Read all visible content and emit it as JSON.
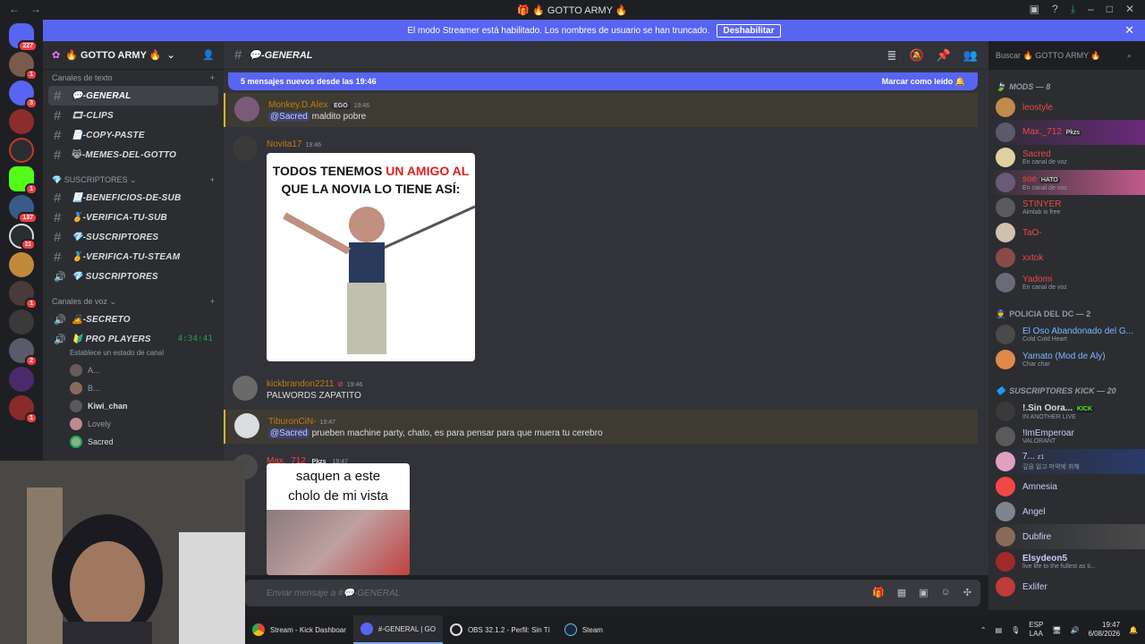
{
  "window": {
    "title": "GOTTO ARMY"
  },
  "banner": {
    "text": "El modo Streamer está habilitado. Los nombres de usuario se han truncado.",
    "button": "Deshabilitar"
  },
  "servers": {
    "badges": [
      "227",
      "1",
      "3",
      "",
      "",
      "",
      "1",
      "1",
      "137",
      "11",
      "",
      "1",
      "1",
      "",
      "2",
      "1",
      "",
      "1"
    ]
  },
  "guild": {
    "name": "GOTTO ARMY"
  },
  "sidebar": {
    "cat_text": "Canales de texto",
    "text_channels": [
      "-GENERAL",
      "-CLIPS",
      "-COPY-PASTE",
      "-MEMES-DEL-GOTTO"
    ],
    "cat_subs": "SUSCRIPTORES",
    "sub_channels": [
      "-BENEFICIOS-DE-SUB",
      "-VERIFICA-TU-SUB",
      "-SUSCRIPTORES",
      "-VERIFICA-TU-STEAM",
      "SUSCRIPTORES"
    ],
    "cat_voice": "Canales de voz",
    "voice_channels": [
      "-SECRETO",
      "PRO PLAYERS"
    ],
    "voice_timer": "4:34:41",
    "voice_status": "Establece un estado de canal",
    "voice_users": [
      "A...",
      "B...",
      "Kiwi_chan",
      "Lovely",
      "Sacred"
    ]
  },
  "chat": {
    "channel": "-GENERAL",
    "new_messages": "5 mensajes nuevos desde las 19:46",
    "mark_read": "Marcar como leído",
    "messages": [
      {
        "user": "Monkey.D.Alex",
        "tag": "EGO",
        "time": "19:46",
        "mention": "@Sacred",
        "text": "maldito pobre"
      },
      {
        "user": "Novita17",
        "time": "19:46"
      },
      {
        "user": "kickbrandon2211",
        "time": "19:46",
        "text": "PALWORDS ZAPATITO"
      },
      {
        "user": "TiburonCiN-",
        "time": "19:47",
        "mention": "@Sacred",
        "text": "prueben machine party, chato, es para pensar para que muera tu cerebro"
      },
      {
        "user": "Max._712",
        "tag": "Pkzs",
        "time": "19:47"
      }
    ],
    "meme1": {
      "line1": "TODOS TENEMOS ",
      "line1_red": "UN AMIGO AL",
      "line2": "QUE LA NOVIA LO TIENE ASÍ:"
    },
    "meme2": {
      "line1": "saquen a este",
      "line2": "cholo de mi vista"
    },
    "input_placeholder": "Enviar mensaje a #",
    "input_channel": "-GENERAL"
  },
  "search": {
    "placeholder": "Buscar",
    "scope": "GOTTO ARMY"
  },
  "members": {
    "mods_header": "MODS — 8",
    "mods": [
      {
        "name": "leostyle",
        "color": "#f04747"
      },
      {
        "name": "Max._712",
        "tag": "Pkzs",
        "color": "#f04747"
      },
      {
        "name": "Sacred",
        "status": "En canal de voz",
        "color": "#f04747"
      },
      {
        "name": "soe",
        "tag": "HATO",
        "status": "En canal de voz",
        "color": "#f04747"
      },
      {
        "name": "STINYER",
        "status": "Aimlab is free",
        "color": "#f04747"
      },
      {
        "name": "TaO-",
        "color": "#f04747"
      },
      {
        "name": "xxtok",
        "color": "#f04747"
      },
      {
        "name": "Yadomi",
        "status": "En canal de voz",
        "color": "#f04747"
      }
    ],
    "policia_header": "POLICIA DEL DC — 2",
    "policia": [
      {
        "name": "El Oso Abandonado del G...",
        "status": "Cold Cold Heart",
        "color": "#7eb8ff"
      },
      {
        "name": "Yamato (Mod de Aly)",
        "status": "Char char",
        "color": "#7eb8ff"
      }
    ],
    "subs_header": "SUSCRIPTORES KICK — 20",
    "subs": [
      {
        "name": "!.Sin Oora...",
        "tag": "KICK",
        "status": "IN ANOTHER LIVE",
        "color": "#dbdee1"
      },
      {
        "name": "!ImEmperoar",
        "status": "VALORANT",
        "color": "#c9cdfb"
      },
      {
        "name": "7...",
        "tag": "z1",
        "status": "깊을 잃고 마약에 취해",
        "color": "#c9cdfb"
      },
      {
        "name": "Amnesia",
        "color": "#c9cdfb"
      },
      {
        "name": "Angel",
        "color": "#c9cdfb"
      },
      {
        "name": "Dubfire",
        "color": "#c9cdfb"
      },
      {
        "name": "Elsydeon5",
        "status": "live life to the fullest as ti...",
        "color": "#c9cdfb"
      },
      {
        "name": "Exlifer",
        "color": "#c9cdfb"
      }
    ]
  },
  "taskbar": {
    "tasks": [
      "Stream - Kick Dashboar",
      "#-GENERAL | GO",
      "OBS 32.1.2 - Perfil: Sin Tí",
      "Steam"
    ],
    "lang1": "ESP",
    "lang2": "LAA",
    "time": "19:47",
    "date": "6/08/2026"
  }
}
